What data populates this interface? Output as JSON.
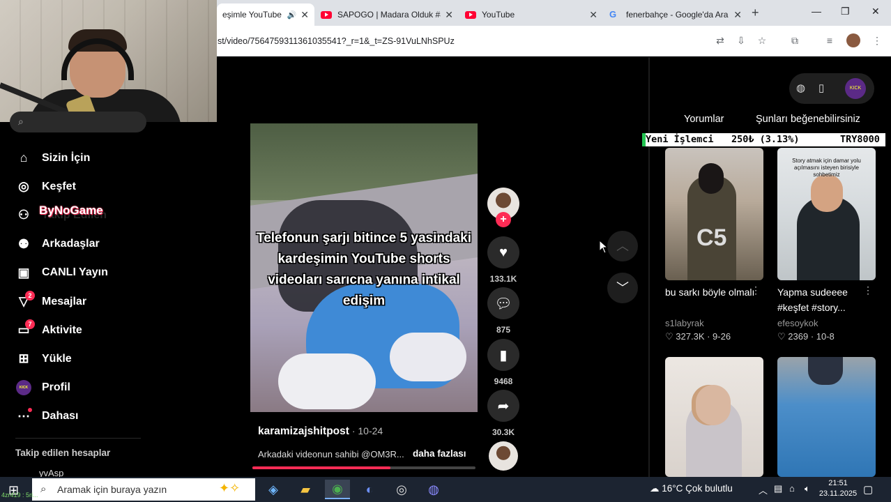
{
  "browser": {
    "tabs": [
      {
        "title": "eşimle YouTube",
        "icon": "speaker-icon",
        "active": true
      },
      {
        "title": "SAPOGO | Madara Olduk #8",
        "icon": "youtube-icon"
      },
      {
        "title": "YouTube",
        "icon": "youtube-icon"
      },
      {
        "title": "fenerbahçe - Google'da Ara",
        "icon": "google-icon"
      }
    ],
    "url": "st/video/7564759311361035541?_r=1&_t=ZS-91VuLNhSPUz"
  },
  "sidebar": {
    "search_placeholder": "Ara",
    "items": [
      {
        "label": "Sizin İçin",
        "icon": "home-icon"
      },
      {
        "label": "Keşfet",
        "icon": "compass-icon"
      },
      {
        "label": "Takip Edilen",
        "icon": "following-icon"
      },
      {
        "label": "Arkadaşlar",
        "icon": "friends-icon"
      },
      {
        "label": "CANLI Yayın",
        "icon": "live-icon"
      },
      {
        "label": "Mesajlar",
        "icon": "messages-icon",
        "badge": "2"
      },
      {
        "label": "Aktivite",
        "icon": "activity-icon",
        "badge": "7"
      },
      {
        "label": "Yükle",
        "icon": "upload-icon"
      },
      {
        "label": "Profil",
        "icon": "profile-avatar"
      },
      {
        "label": "Dahası",
        "icon": "more-icon"
      }
    ],
    "overlay_text": "ByNoGame",
    "following_title": "Takip edilen hesaplar",
    "following_account": "yvAsp"
  },
  "video": {
    "caption": "Telefonun şarjı bitince 5 yasindaki kardeşimin YouTube shorts videoları sarıcna yanına intikal edişim",
    "author": "karamizajshitpost",
    "date": "10-24",
    "description": "Arkadaki videonun sahibi @OM3R...",
    "more_label": "daha fazlası",
    "progress": 0.62
  },
  "actions": {
    "likes": "133.1K",
    "comments": "875",
    "saves": "9468",
    "shares": "30.3K"
  },
  "right_panel": {
    "tab_comments": "Yorumlar",
    "tab_suggested": "Şunları beğenebilirsiniz",
    "ticker": {
      "label": "Yeni İşlemci",
      "amount": "250₺ (3.13%)",
      "goal": "TRY8000"
    },
    "cards": [
      {
        "title": "bu sarkı böyle olmalı",
        "user": "s1labyrak",
        "likes": "327.3K",
        "date": "9-26"
      },
      {
        "title": "Yapma sudeeee #keşfet #story...",
        "user": "efesoykok",
        "likes": "2369",
        "date": "10-8",
        "thumb_caption": "Story atmak için damar yolu açılmasını isteyen birisiyle sohbetimiz"
      },
      {
        "title": "",
        "user": "",
        "likes": "",
        "date": ""
      },
      {
        "title": "",
        "user": "",
        "likes": "",
        "date": ""
      }
    ]
  },
  "taskbar": {
    "search_placeholder": "Aramak için buraya yazın",
    "weather": "16°C  Çok bulutlu",
    "time": "21:51",
    "date": "23.11.2025",
    "corner_overlay": "4zr419 : 5ri..."
  }
}
